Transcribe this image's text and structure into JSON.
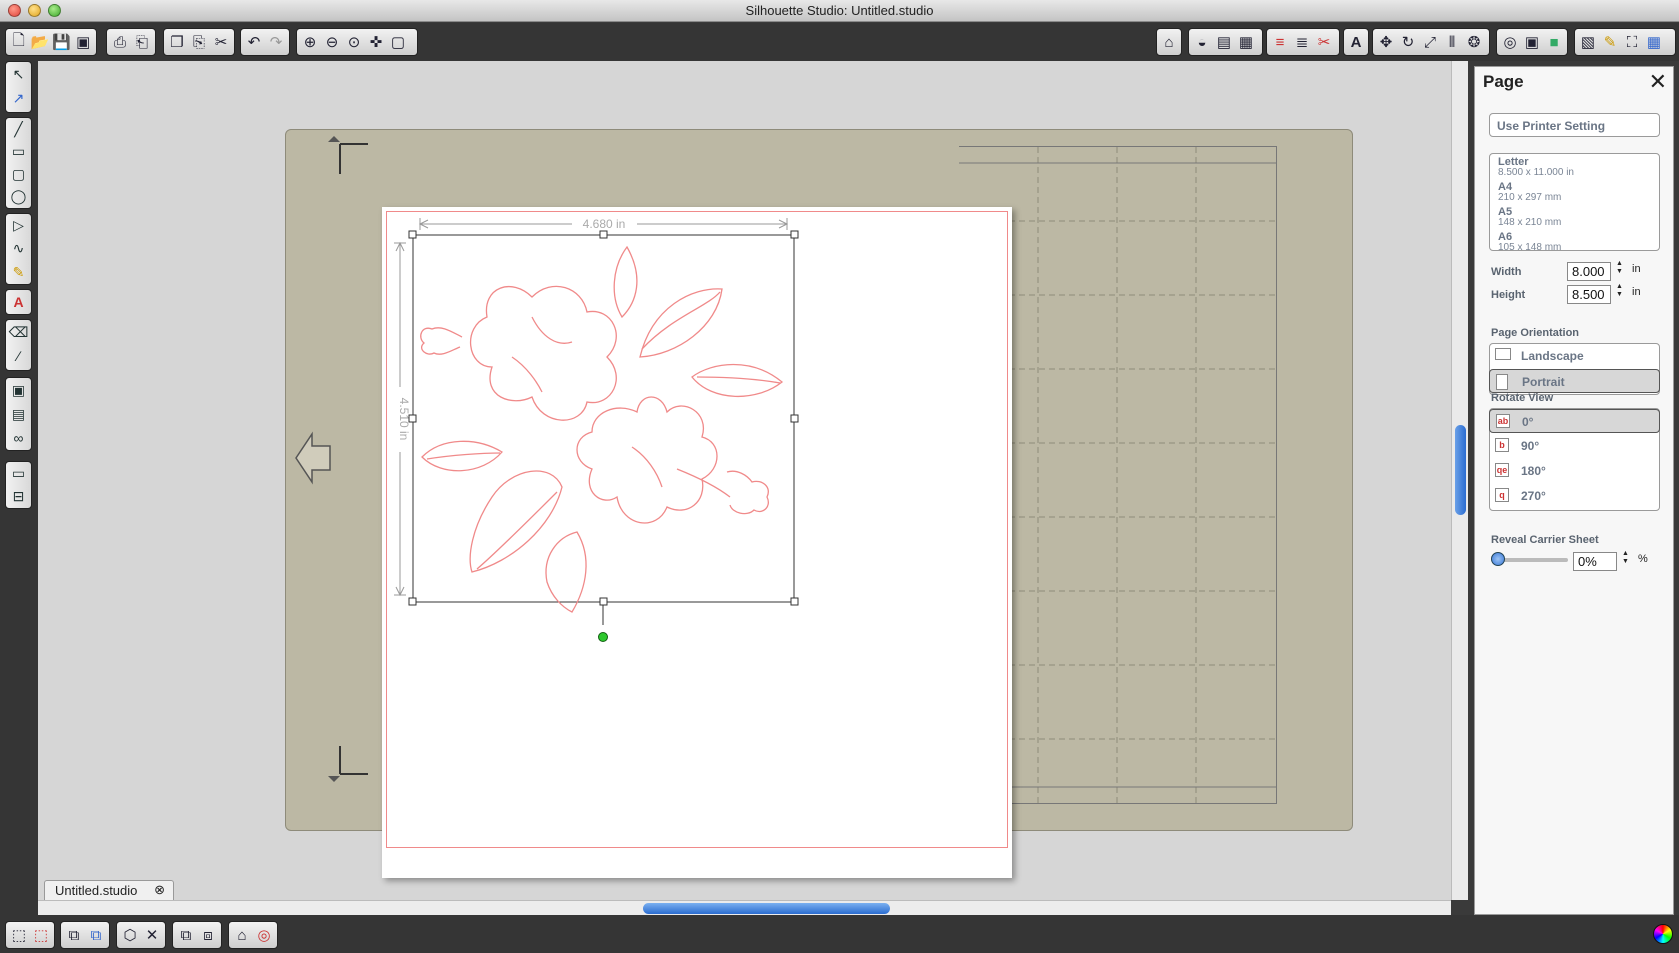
{
  "window": {
    "title": "Silhouette Studio: Untitled.studio"
  },
  "toolbar": {
    "file_icons": [
      "new-document-icon",
      "open-icon",
      "save-icon",
      "save-to-library-icon"
    ],
    "print_icons": [
      "print-icon",
      "print-and-cut-icon"
    ],
    "edit_icons": [
      "copy-icon",
      "paste-icon",
      "cut-icon"
    ],
    "history_icons": [
      "undo-icon",
      "redo-icon"
    ],
    "zoom_icons": [
      "zoom-in-icon",
      "zoom-out-icon",
      "zoom-selection-icon",
      "pan-icon",
      "fit-to-page-icon"
    ],
    "right_icons": [
      "library-icon",
      "fill-icon",
      "page-settings-icon",
      "grid-settings-icon",
      "line-color-icon",
      "line-style-icon",
      "cut-settings-icon",
      "text-style-icon",
      "transform-icon",
      "rotate-icon",
      "scale-icon",
      "align-icon",
      "replicate-icon",
      "offset-icon",
      "trace-icon",
      "modify-icon",
      "send-to-silhouette-icon",
      "sketch-icon",
      "fullscreen-icon",
      "grid-icon"
    ]
  },
  "canvas": {
    "width_label": "4.680 in",
    "height_label": "4.510 in",
    "tab_label": "Untitled.studio"
  },
  "panel": {
    "title": "Page",
    "printer_setting": "Use Printer Setting",
    "sizes": [
      {
        "name": "Letter",
        "dims": "8.500 x 11.000 in"
      },
      {
        "name": "A4",
        "dims": "210 x 297 mm"
      },
      {
        "name": "A5",
        "dims": "148 x 210 mm"
      },
      {
        "name": "A6",
        "dims": "105 x 148 mm"
      }
    ],
    "width_label": "Width",
    "width_value": "8.000",
    "height_label": "Height",
    "height_value": "8.500",
    "unit": "in",
    "orientation_label": "Page Orientation",
    "orientations": [
      "Landscape",
      "Portrait"
    ],
    "orientation_selected": "Portrait",
    "rotate_label": "Rotate View",
    "rotations": [
      "0°",
      "90°",
      "180°",
      "270°"
    ],
    "rotation_selected": "0°",
    "reveal_label": "Reveal Carrier Sheet",
    "reveal_value": "0%",
    "reveal_unit": "%"
  },
  "colors": {
    "cut_line": "#f08a8a",
    "mat": "#bcb8a4",
    "accent": "#2a6cd0"
  }
}
